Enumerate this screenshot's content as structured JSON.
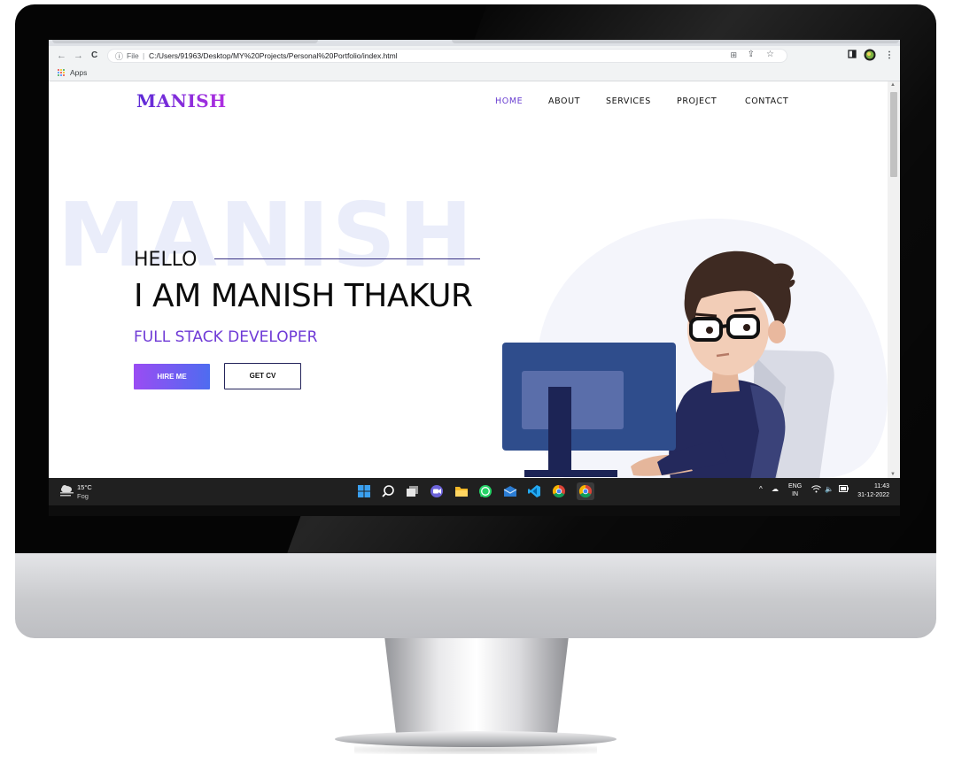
{
  "browser": {
    "nav": {
      "back_icon": "←",
      "forward_icon": "→",
      "reload_icon": "C"
    },
    "omnibox": {
      "file_label": "File",
      "separator": "|",
      "url": "C:/Users/91963/Desktop/MY%20Projects/Personal%20Portfolio/index.html"
    },
    "bookmarks": {
      "apps_label": "Apps"
    }
  },
  "site": {
    "logo": "MANISH",
    "nav": [
      {
        "label": "HOME",
        "active": true
      },
      {
        "label": "ABOUT",
        "active": false
      },
      {
        "label": "SERVICES",
        "active": false
      },
      {
        "label": "PROJECT",
        "active": false
      },
      {
        "label": "CONTACT",
        "active": false
      }
    ],
    "hero": {
      "watermark": "MANISH",
      "greeting": "HELLO",
      "name": "I AM MANISH THAKUR",
      "role": "FULL STACK DEVELOPER",
      "hire_button": "HIRE ME",
      "cv_button": "GET CV"
    }
  },
  "colors": {
    "accent": "#6f3ad6",
    "button_gradient_start": "#9a4cf3",
    "button_gradient_end": "#4e6cf0"
  },
  "taskbar": {
    "weather": {
      "temp": "15°C",
      "desc": "Fog"
    },
    "apps": [
      "start-icon",
      "search-icon",
      "task-view-icon",
      "chat-icon",
      "file-explorer-icon",
      "whatsapp-icon",
      "mail-icon",
      "vscode-icon",
      "chrome-icon",
      "chrome-active-icon"
    ],
    "tray": {
      "lang_top": "ENG",
      "lang_bottom": "IN",
      "time": "11:43",
      "date": "31-12-2022"
    }
  }
}
